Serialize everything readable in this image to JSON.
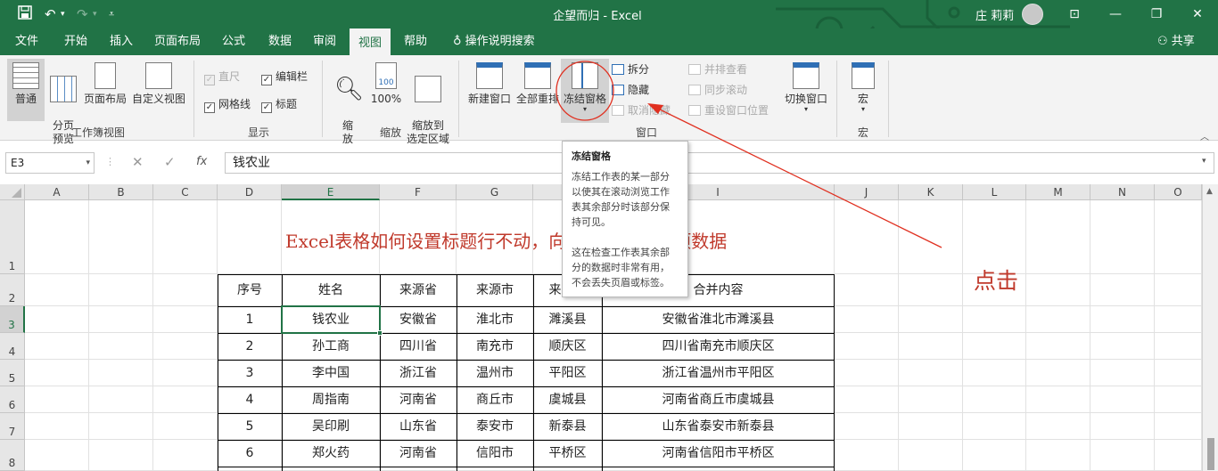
{
  "titlebar": {
    "title": "企望而归 - Excel",
    "user": "庄 莉莉",
    "save_icon": "save-icon",
    "undo_icon": "undo-icon",
    "redo_icon": "redo-icon",
    "customize_icon": "customize-qa-icon"
  },
  "tabs": [
    "文件",
    "开始",
    "插入",
    "页面布局",
    "公式",
    "数据",
    "审阅",
    "视图",
    "帮助"
  ],
  "active_tab": "视图",
  "tellme": "操作说明搜索",
  "share": "共享",
  "ribbon": {
    "workbook_views": {
      "normal": "普通",
      "page_break": "分页\n预览",
      "page_layout": "页面布局",
      "custom": "自定义视图",
      "group": "工作簿视图"
    },
    "show": {
      "ruler": "直尺",
      "formula_bar": "编辑栏",
      "gridlines": "网格线",
      "headings": "标题",
      "group": "显示"
    },
    "zoom": {
      "zoom": "缩\n放",
      "hundred": "100%",
      "zoom_selection": "缩放到\n选定区域",
      "group": "缩放"
    },
    "window": {
      "new_window": "新建窗口",
      "arrange_all": "全部重排",
      "freeze_panes": "冻结窗格",
      "split": "拆分",
      "hide": "隐藏",
      "unhide": "取消隐藏",
      "side_by_side": "并排查看",
      "sync_scroll": "同步滚动",
      "reset_position": "重设窗口位置",
      "switch_windows": "切换窗口",
      "group": "窗口"
    },
    "macros": {
      "macros": "宏",
      "group": "宏"
    }
  },
  "formula_bar": {
    "name_box": "E3",
    "cancel": "✕",
    "enter": "✓",
    "fx": "fx",
    "value": "钱农业"
  },
  "columns": [
    "A",
    "B",
    "C",
    "D",
    "E",
    "F",
    "G",
    "H",
    "I",
    "J",
    "K",
    "L",
    "M",
    "N",
    "O"
  ],
  "rows": [
    "1",
    "2",
    "3",
    "4",
    "5",
    "6",
    "7",
    "8"
  ],
  "sheet_title": "Excel表格如何设置标题行不动，向下滚动查看各项数据",
  "table": {
    "headers": [
      "序号",
      "姓名",
      "来源省",
      "来源市",
      "来源县",
      "合并内容"
    ],
    "rows": [
      [
        "1",
        "钱农业",
        "安徽省",
        "淮北市",
        "濉溪县",
        "安徽省淮北市濉溪县"
      ],
      [
        "2",
        "孙工商",
        "四川省",
        "南充市",
        "顺庆区",
        "四川省南充市顺庆区"
      ],
      [
        "3",
        "李中国",
        "浙江省",
        "温州市",
        "平阳区",
        "浙江省温州市平阳区"
      ],
      [
        "4",
        "周指南",
        "河南省",
        "商丘市",
        "虞城县",
        "河南省商丘市虞城县"
      ],
      [
        "5",
        "吴印刷",
        "山东省",
        "泰安市",
        "新泰县",
        "山东省泰安市新泰县"
      ],
      [
        "6",
        "郑火药",
        "河南省",
        "信阳市",
        "平桥区",
        "河南省信阳市平桥区"
      ]
    ]
  },
  "tooltip": {
    "title": "冻结窗格",
    "para1": "冻结工作表的某一部分以使其在滚动浏览工作表其余部分时该部分保持可见。",
    "para2": "这在检查工作表其余部分的数据时非常有用，不会丢失页眉或标签。"
  },
  "annotation": "点击",
  "colors": {
    "excel_green": "#217346",
    "annotation_red": "#c0392b"
  }
}
